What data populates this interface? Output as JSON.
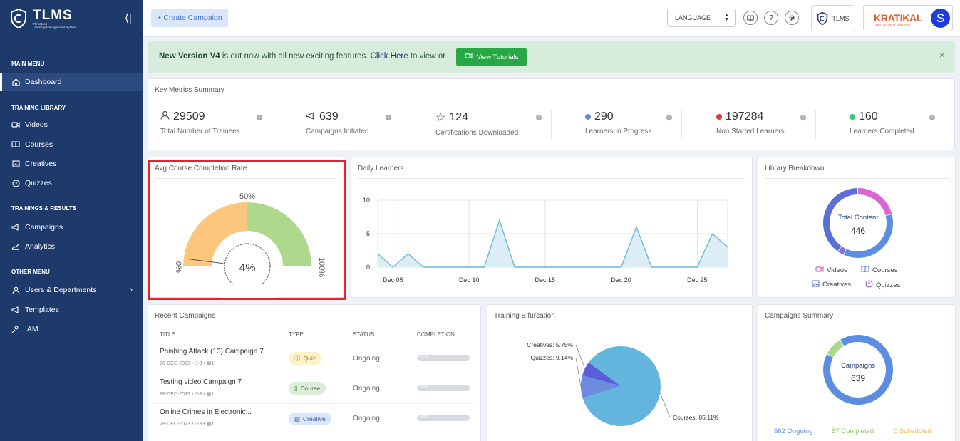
{
  "brand": {
    "title": "TLMS",
    "subtitle_line1": "Threatcop",
    "subtitle_line2": "Learning Management System",
    "collapse_glyph": "⟨|"
  },
  "sidebar": {
    "sections": [
      {
        "title": "MAIN MENU"
      },
      {
        "title": "TRAINING LIBRARY"
      },
      {
        "title": "TRAININGS & RESULTS"
      },
      {
        "title": "OTHER MENU"
      }
    ],
    "items": [
      {
        "label": "Dashboard",
        "icon": "home-icon",
        "active": true
      },
      {
        "label": "Videos",
        "icon": "video-icon"
      },
      {
        "label": "Courses",
        "icon": "book-icon"
      },
      {
        "label": "Creatives",
        "icon": "image-icon"
      },
      {
        "label": "Quizzes",
        "icon": "question-icon"
      },
      {
        "label": "Campaigns",
        "icon": "megaphone-icon"
      },
      {
        "label": "Analytics",
        "icon": "analytics-icon"
      },
      {
        "label": "Users & Departments",
        "icon": "user-icon"
      },
      {
        "label": "Templates",
        "icon": "megaphone-icon"
      },
      {
        "label": "IAM",
        "icon": "iam-icon"
      }
    ]
  },
  "topbar": {
    "create_label": "+ Create Campaign",
    "language_label": "LANGUAGE",
    "tlms_label": "TLMS",
    "partner_logo": "KRATIKAL",
    "partner_tagline": "CYBER SECURITY SIMPLIFIED",
    "avatar_initial": "S"
  },
  "alert": {
    "bold": "New Version V4",
    "text": " is out now with all new exciting features. ",
    "link": "Click Here",
    "text2": " to view or",
    "button": "View Tutorials",
    "close": "×"
  },
  "metrics": {
    "title": "Key Metrics Summary",
    "items": [
      {
        "value": "29509",
        "label": "Total Number of Trainees",
        "icon": "user-icon"
      },
      {
        "value": "639",
        "label": "Campaigns Initiated",
        "icon": "megaphone-icon"
      },
      {
        "value": "124",
        "label": "Certifications Downloaded",
        "icon": "star-icon"
      },
      {
        "value": "290",
        "label": "Learners In Progress",
        "dot_color": "#5b8ee0"
      },
      {
        "value": "197284",
        "label": "Non Started Learners",
        "dot_color": "#e53935"
      },
      {
        "value": "160",
        "label": "Learners Completed",
        "dot_color": "#2ecc71"
      }
    ],
    "info_glyph": "i"
  },
  "gauge": {
    "title": "Avg Course Completion Rate",
    "center": "4%",
    "label_mid": "50%",
    "label_min": "0%",
    "label_max": "100%",
    "value": 4,
    "colors": {
      "low": "#fdc67d",
      "high": "#aed88b"
    }
  },
  "daily": {
    "title": "Daily Learners",
    "chart_data": {
      "type": "area",
      "x": [
        "Dec 04",
        "Dec 05",
        "Dec 06",
        "Dec 07",
        "Dec 08",
        "Dec 09",
        "Dec 10",
        "Dec 11",
        "Dec 12",
        "Dec 13",
        "Dec 14",
        "Dec 15",
        "Dec 16",
        "Dec 17",
        "Dec 18",
        "Dec 19",
        "Dec 20",
        "Dec 21",
        "Dec 22",
        "Dec 23",
        "Dec 24",
        "Dec 25",
        "Dec 26",
        "Dec 27",
        "Dec 28",
        "Dec 29"
      ],
      "values": [
        2,
        0,
        2,
        0,
        0,
        0,
        0,
        0,
        7,
        0,
        0,
        0,
        0,
        0,
        0,
        0,
        0,
        6,
        0,
        0,
        0,
        0,
        5,
        3
      ],
      "x_ticks": [
        "Dec 05",
        "Dec 10",
        "Dec 15",
        "Dec 20",
        "Dec 25"
      ],
      "y_ticks": [
        "10",
        "5",
        "0"
      ],
      "ylim": [
        0,
        10
      ],
      "color": "#6bbad6"
    }
  },
  "library": {
    "title": "Library Breakdown",
    "center_label": "Total Content",
    "center_value": "446",
    "legend": [
      {
        "label": "Videos",
        "color": "#d966d0",
        "icon": "video-icon"
      },
      {
        "label": "Courses",
        "color": "#5b7fe0",
        "icon": "book-icon"
      },
      {
        "label": "Creatives",
        "color": "#5b7fe0",
        "icon": "image-icon"
      },
      {
        "label": "Quizzes",
        "color": "#a355c9",
        "icon": "question-icon"
      }
    ],
    "chart_data": {
      "type": "pie",
      "labels": [
        "Videos",
        "Courses",
        "Creatives",
        "Quizzes"
      ],
      "values": [
        21,
        36,
        3,
        40
      ],
      "colors": [
        "#d966d0",
        "#5b8ee0",
        "#8a6fe0",
        "#5a6fd8"
      ]
    }
  },
  "recent": {
    "title": "Recent Campaigns",
    "headers": [
      "TITLE",
      "TYPE",
      "STATUS",
      "COMPLETION"
    ],
    "rows": [
      {
        "title": "Phishing Attack (13) Campaign 7",
        "date": "28-DEC-2023",
        "users": "3",
        "items": "1",
        "type": "Quiz",
        "type_icon": "question-icon",
        "status": "Ongoing",
        "completion": "0.00%"
      },
      {
        "title": "Testing video Campaign 7",
        "date": "28-DEC-2023",
        "users": "3",
        "items": "1",
        "type": "Course",
        "type_icon": "book-icon",
        "status": "Ongoing",
        "completion": "0.00%"
      },
      {
        "title": "Online Crimes in Electronic...",
        "date": "28-DEC-2023",
        "users": "3",
        "items": "1",
        "type": "Creative",
        "type_icon": "image-icon",
        "status": "Ongoing",
        "completion": "0.00%"
      }
    ]
  },
  "bifurcation": {
    "title": "Training Bifurcation",
    "chart_data": {
      "type": "pie",
      "labels": [
        "Courses",
        "Quizzes",
        "Creatives"
      ],
      "values": [
        85.11,
        9.14,
        5.75
      ],
      "display": [
        "Courses: 85.11%",
        "Quizzes: 9.14%",
        "Creatives: 5.75%"
      ],
      "colors": [
        "#64b5dd",
        "#6c8ce0",
        "#5a5fd8"
      ]
    }
  },
  "campaigns_summary": {
    "title": "Campaigns Summary",
    "center_label": "Campaigns",
    "center_value": "639",
    "legend": [
      "582 Ongoing",
      "57 Completed",
      "0 Scheduled"
    ],
    "chart_data": {
      "type": "pie",
      "labels": [
        "Ongoing",
        "Completed",
        "Scheduled"
      ],
      "values": [
        582,
        57,
        0
      ],
      "colors": [
        "#5b8ee0",
        "#a8d88c",
        "#f4c77d"
      ]
    }
  }
}
